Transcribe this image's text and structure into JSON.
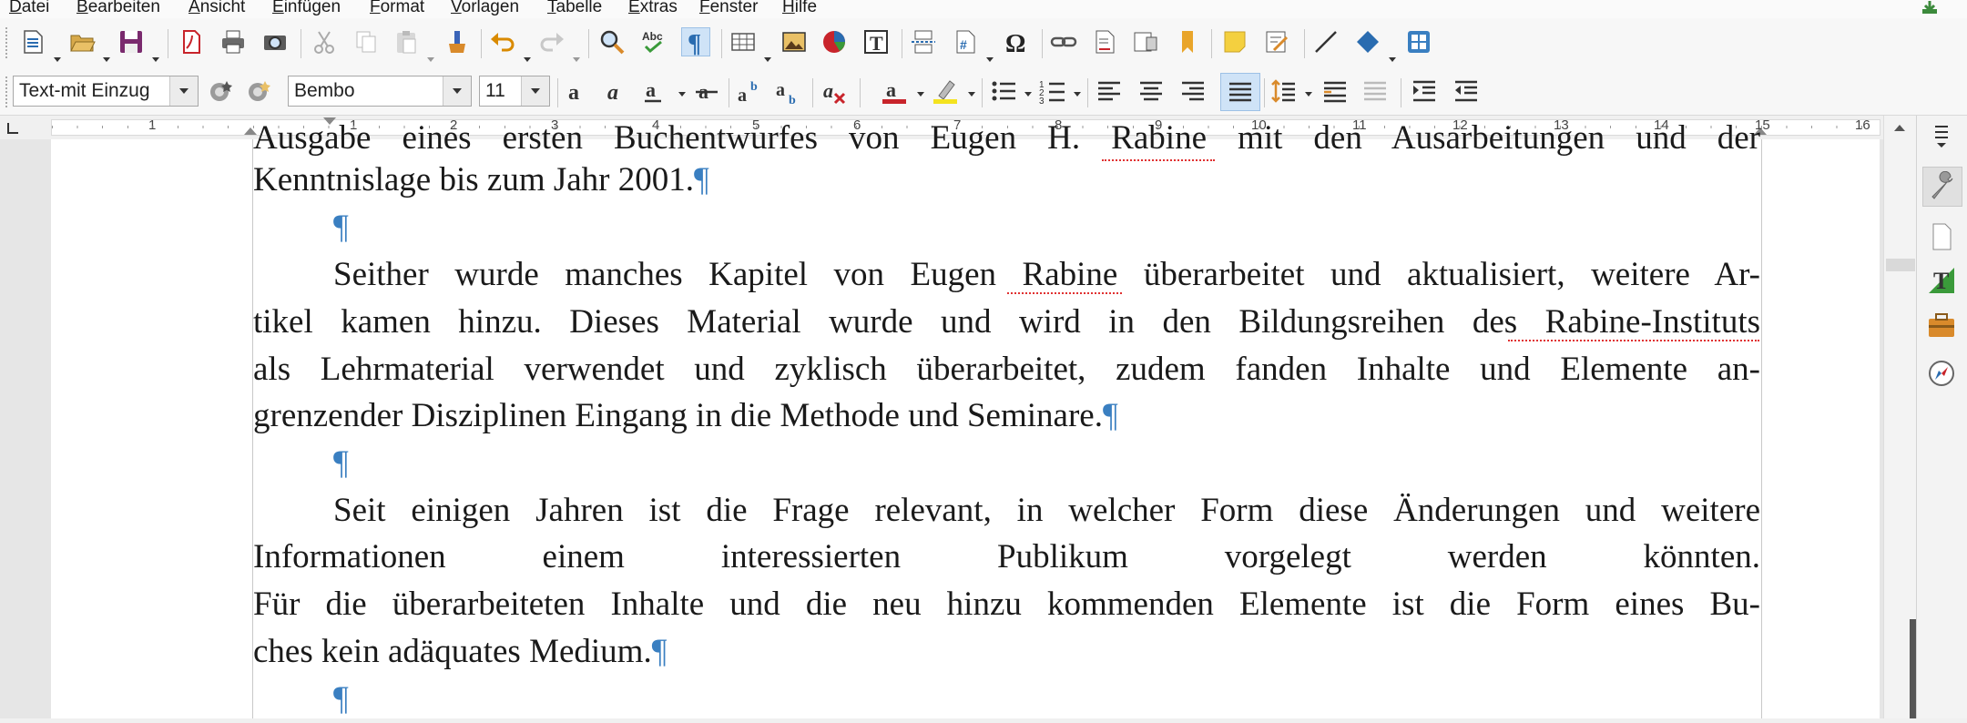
{
  "menu": [
    "Datei",
    "Bearbeiten",
    "Ansicht",
    "Einfügen",
    "Format",
    "Vorlagen",
    "Tabelle",
    "Extras",
    "Fenster",
    "Hilfe"
  ],
  "formatting": {
    "paragraph_style": "Text-mit Einzug",
    "font_name": "Bembo",
    "font_size": "11"
  },
  "ruler": {
    "numbers": [
      "1",
      "1",
      "2",
      "3",
      "4",
      "5",
      "6",
      "7",
      "8",
      "9",
      "10",
      "11",
      "12",
      "13",
      "14",
      "15",
      "16"
    ]
  },
  "document": {
    "lines": [
      "Ausgabe eines ersten Buchentwurfes von Eugen H. Rabine mit den Ausarbeitungen und der",
      "Kenntnislage bis zum Jahr 2001.",
      "",
      "Seither wurde manches Kapitel von Eugen Rabine überarbeitet und aktualisiert, weitere Ar-",
      "tikel kamen hinzu. Dieses Material wurde und wird in den Bildungsreihen des Rabine-Instituts",
      "als Lehrmaterial verwendet und zyklisch überarbeitet, zudem fanden Inhalte und Elemente an-",
      "grenzender Disziplinen Eingang in die Methode und Seminare.",
      "",
      "Seit einigen Jahren ist die Frage relevant, in welcher Form diese Änderungen und weitere",
      "Informationen einem interessierten Publikum vorgelegt werden könnten.",
      "Für die überarbeiteten Inhalte und die neu hinzu kommenden Elemente ist die Form eines Bu-",
      "ches kein adäquates Medium.",
      ""
    ],
    "pilcrow": "¶"
  },
  "colors": {
    "accent": "#3a7fc1",
    "active_button": "#cfe3f7"
  }
}
